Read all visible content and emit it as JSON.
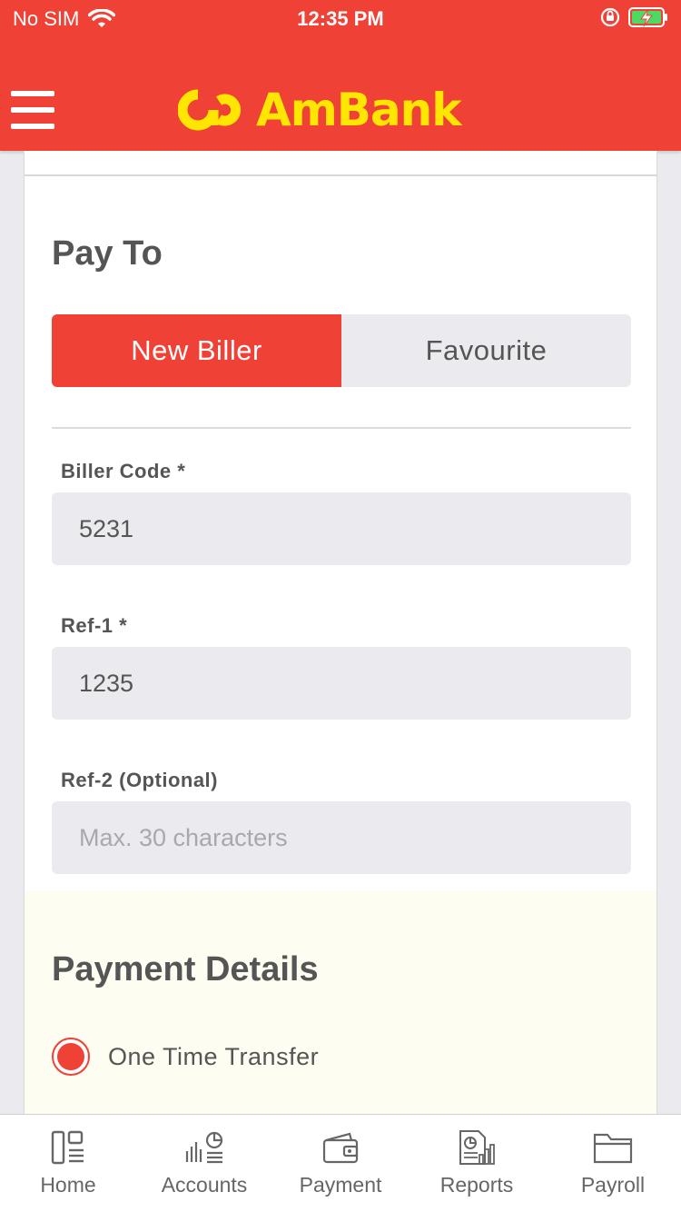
{
  "status_bar": {
    "carrier": "No SIM",
    "time": "12:35 PM"
  },
  "header": {
    "brand": "AmBank",
    "menu_icon": "hamburger-icon",
    "colors": {
      "primary": "#ef4136",
      "logo": "#ffe600"
    }
  },
  "pay_to": {
    "title": "Pay To",
    "tabs": {
      "new_biller": "New Biller",
      "favourite": "Favourite",
      "active": "New Biller"
    },
    "fields": {
      "biller_code": {
        "label": "Biller Code *",
        "value": "5231"
      },
      "ref1": {
        "label": "Ref-1 *",
        "value": "1235"
      },
      "ref2": {
        "label": "Ref-2 (Optional)",
        "value": "",
        "placeholder": "Max. 30 characters"
      }
    }
  },
  "payment_details": {
    "title": "Payment Details",
    "option": "One Time Transfer",
    "selected": true
  },
  "tab_bar": {
    "items": [
      {
        "label": "Home",
        "icon": "home-dashboard-icon"
      },
      {
        "label": "Accounts",
        "icon": "accounts-chart-icon"
      },
      {
        "label": "Payment",
        "icon": "wallet-icon"
      },
      {
        "label": "Reports",
        "icon": "report-document-icon"
      },
      {
        "label": "Payroll",
        "icon": "folder-icon"
      }
    ]
  }
}
